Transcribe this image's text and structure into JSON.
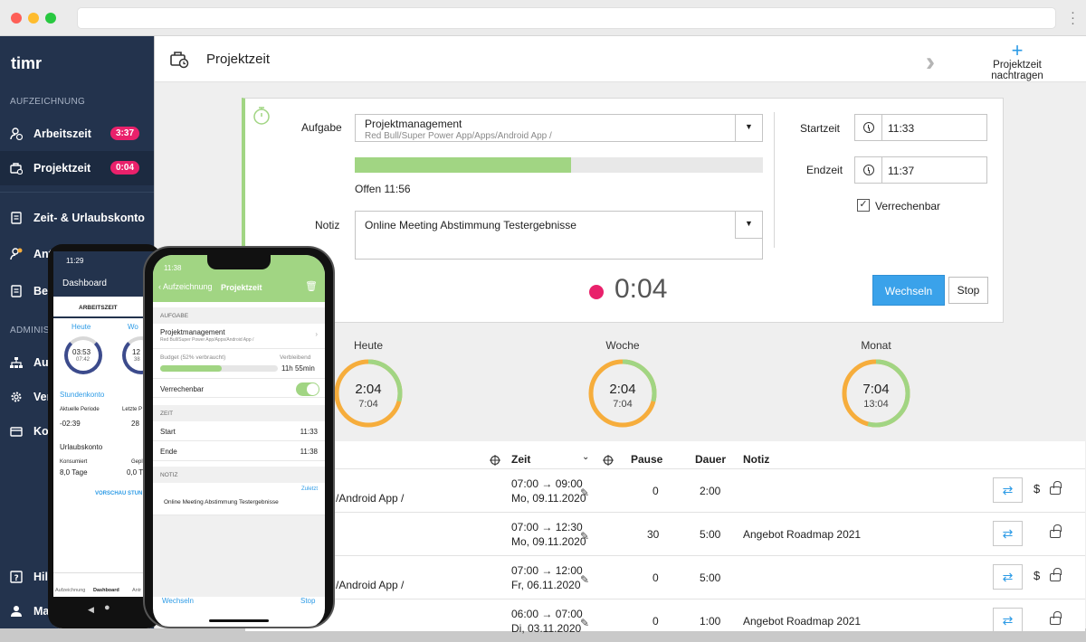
{
  "sidebar": {
    "logo": "timr",
    "section1": "AUFZEICHNUNG",
    "items": [
      {
        "label": "Arbeitszeit",
        "badge": "3:37"
      },
      {
        "label": "Projektzeit",
        "badge": "0:04"
      },
      {
        "label": "Zeit- & Urlaubskonto"
      },
      {
        "label": "Antr"
      },
      {
        "label": "Ber"
      }
    ],
    "section2": "ADMINIST",
    "items2": [
      {
        "label": "Auf"
      },
      {
        "label": "Ver"
      },
      {
        "label": "Kon"
      },
      {
        "label": "Hilf"
      },
      {
        "label": "Ma"
      }
    ]
  },
  "header": {
    "title": "Projektzeit",
    "add_label": "Projektzeit nachtragen"
  },
  "form": {
    "aufgabe_label": "Aufgabe",
    "task_name": "Projektmanagement",
    "task_path": "Red Bull/Super Power App/Apps/Android App /",
    "progress": 0.53,
    "offen": "Offen 11:56",
    "notiz_label": "Notiz",
    "notiz_value": "Online Meeting Abstimmung Testergebnisse",
    "startzeit_label": "Startzeit",
    "startzeit": "11:33",
    "endzeit_label": "Endzeit",
    "endzeit": "11:37",
    "verrechenbar_label": "Verrechenbar",
    "verrechenbar": true,
    "timer": "0:04",
    "switch_label": "Wechseln",
    "stop_label": "Stop"
  },
  "summary": [
    {
      "label": "Heute",
      "v1": "2:04",
      "v2": "7:04",
      "fraction": 0.29
    },
    {
      "label": "Woche",
      "v1": "2:04",
      "v2": "7:04",
      "fraction": 0.29
    },
    {
      "label": "Monat",
      "v1": "7:04",
      "v2": "13:04",
      "fraction": 0.54
    }
  ],
  "table": {
    "headers": {
      "zeit": "Zeit",
      "pause": "Pause",
      "dauer": "Dauer",
      "notiz": "Notiz"
    },
    "rows": [
      {
        "task": "/Android App /",
        "range": "07:00 → 09:00",
        "date": "Mo, 09.11.2020",
        "pause": "0",
        "dauer": "2:00",
        "notiz": "",
        "billable": true
      },
      {
        "task": "",
        "range": "07:00 → 12:30",
        "date": "Mo, 09.11.2020",
        "pause": "30",
        "dauer": "5:00",
        "notiz": "Angebot Roadmap 2021",
        "billable": false
      },
      {
        "task": "/Android App /",
        "range": "07:00 → 12:00",
        "date": "Fr, 06.11.2020",
        "pause": "0",
        "dauer": "5:00",
        "notiz": "",
        "billable": true
      },
      {
        "task": "",
        "range": "06:00 → 07:00",
        "date": "Di, 03.11.2020",
        "pause": "0",
        "dauer": "1:00",
        "notiz": "Angebot Roadmap 2021",
        "billable": false
      }
    ]
  },
  "android": {
    "time": "11:29",
    "title": "Dashboard",
    "tab": "ARBEITSZEIT",
    "heute": "Heute",
    "woche": "Wo",
    "ring1_main": "03:53",
    "ring1_sub": "07:42",
    "ring2_main": "12",
    "ring2_sub": "38",
    "stundenkonto": "Stundenkonto",
    "aktuelle": "Aktuelle Periode",
    "letzte": "Letzte P",
    "val1": "-02:39",
    "val2": "28",
    "urlaubskonto": "Urlaubskonto",
    "konsumiert": "Konsumiert",
    "gepl": "Gepl",
    "tage": "8,0 Tage",
    "tage2": "0,0 T",
    "vorschau": "VORSCHAU STUN",
    "nav1": "Aufzeichnung",
    "nav2": "Dashboard",
    "nav3": "Antr"
  },
  "iphone": {
    "time": "11:38",
    "back": "Aufzeichnung",
    "title": "Projektzeit",
    "sec_aufgabe": "AUFGABE",
    "task": "Projektmanagement",
    "path": "Red Bull/Super Power App/Apps/Android App /",
    "budget": "Budget (52% verbraucht)",
    "verbleibend": "Verbleibend",
    "remaining": "11h 55min",
    "budget_fraction": 0.52,
    "verrechenbar": "Verrechenbar",
    "sec_zeit": "ZEIT",
    "start": "Start",
    "start_val": "11:33",
    "ende": "Ende",
    "ende_val": "11:38",
    "sec_notiz": "NOTIZ",
    "zuletzt": "Zuletzt",
    "note": "Online Meeting Abstimmung Testergebnisse",
    "wechseln": "Wechseln",
    "stop": "Stop"
  },
  "colors": {
    "accent": "#3aa2ea",
    "green": "#a1d583",
    "orange": "#f6ad3c",
    "pink": "#e9216b",
    "sidebar": "#23334d"
  }
}
